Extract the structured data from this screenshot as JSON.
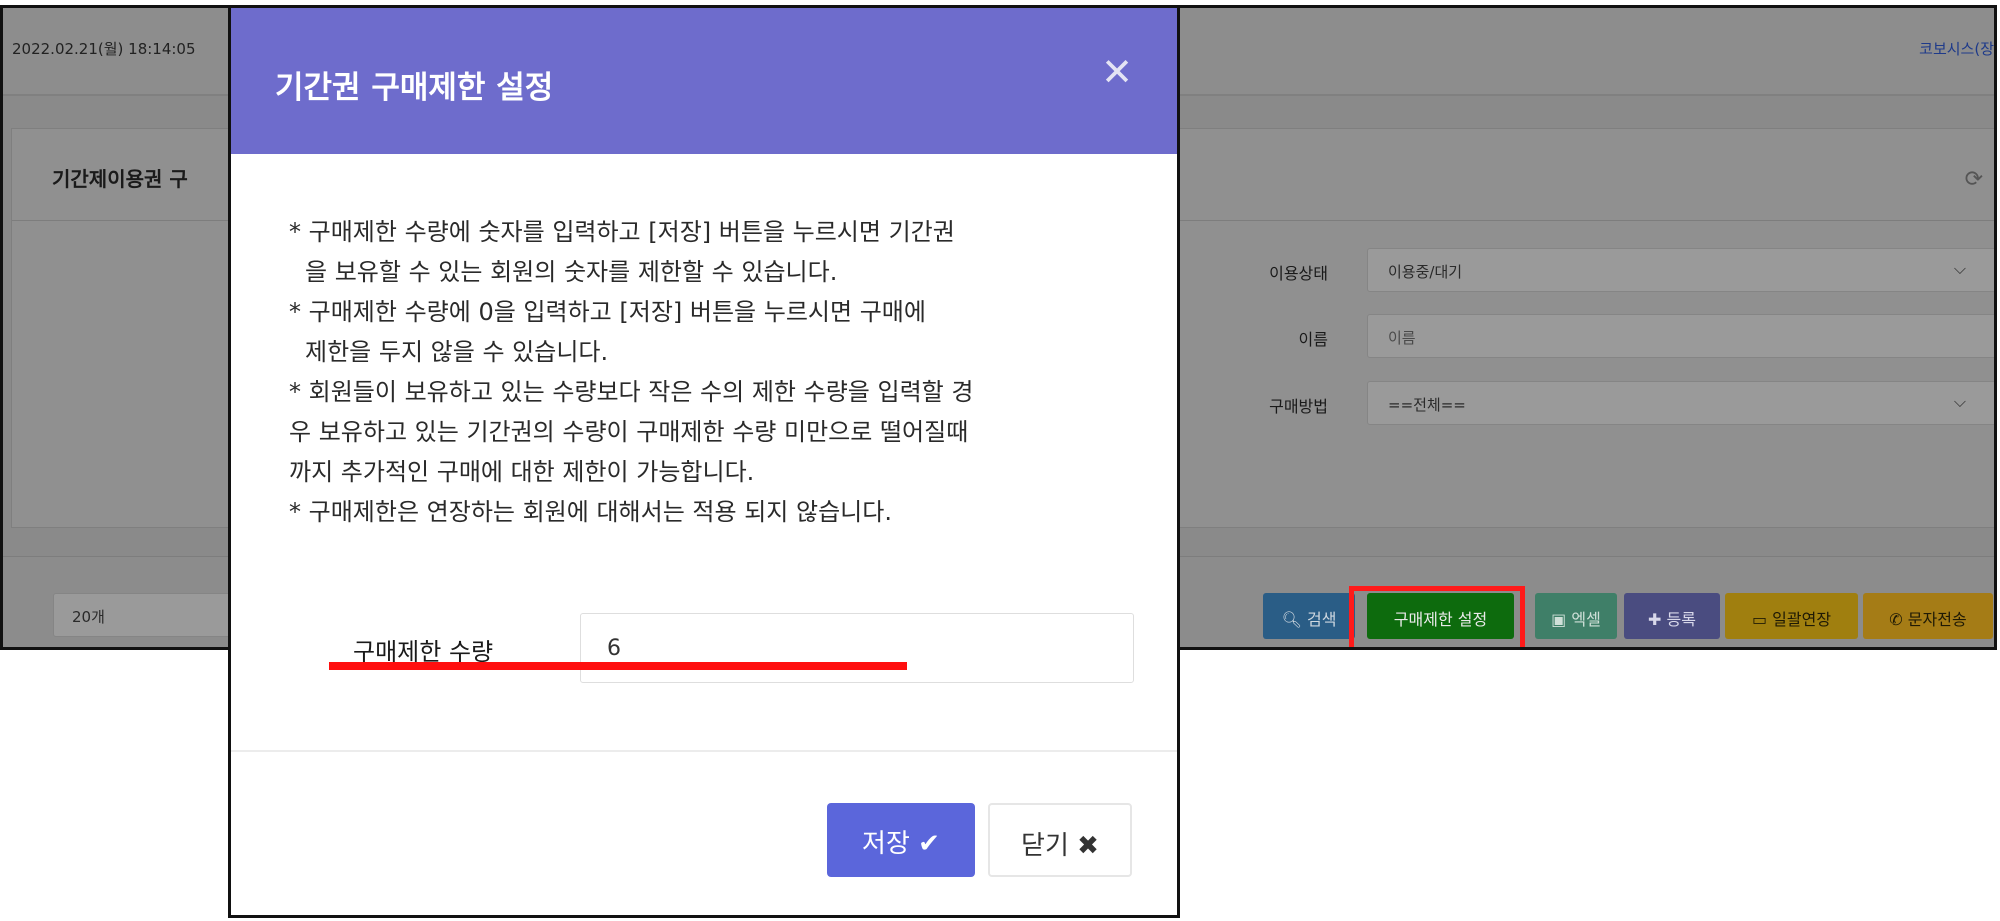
{
  "background": {
    "datetime": "2022.02.21(월) 18:14:05",
    "company": "코보시스(장",
    "panel_title": "기간제이용권 구",
    "filters": [
      {
        "label": "이용상태",
        "value": "이용중/대기"
      },
      {
        "label": "이름",
        "placeholder": "이름"
      },
      {
        "label": "구매방법",
        "value": "==전체=="
      }
    ],
    "page_size": "20개",
    "buttons": {
      "search": "검색",
      "purchase_limit": "구매제한 설정",
      "excel": "엑셀",
      "register": "등록",
      "bulk_extend": "일괄연장",
      "sms": "문자전송"
    },
    "icons": {
      "search": "search-icon",
      "excel": "excel-icon",
      "register": "plus-icon",
      "extend": "calendar-icon",
      "sms": "phone-icon",
      "refresh": "refresh-icon"
    }
  },
  "modal": {
    "title": "기간권 구매제한 설정",
    "notices": [
      "* 구매제한 수량에 숫자를 입력하고 [저장] 버튼을 누르시면 기간권",
      "  을 보유할 수 있는 회원의 숫자를 제한할 수 있습니다.",
      "* 구매제한 수량에 0을 입력하고 [저장] 버튼을 누르시면 구매에",
      "  제한을 두지 않을 수 있습니다.",
      "* 회원들이 보유하고 있는 수량보다 작은 수의 제한 수량을 입력할 경",
      "우 보유하고 있는 기간권의 수량이 구매제한 수량 미만으로 떨어질때",
      "까지 추가적인 구매에 대한 제한이 가능합니다.",
      "* 구매제한은 연장하는 회원에 대해서는 적용 되지 않습니다."
    ],
    "quantity_label": "구매제한 수량",
    "quantity_value": "6",
    "save_label": "저장",
    "close_label": "닫기"
  },
  "colors": {
    "modal_header": "#6e6ccc",
    "save_button": "#5b66db",
    "highlight": "#ff1a1a",
    "limit_button": "#0d6b0d"
  }
}
